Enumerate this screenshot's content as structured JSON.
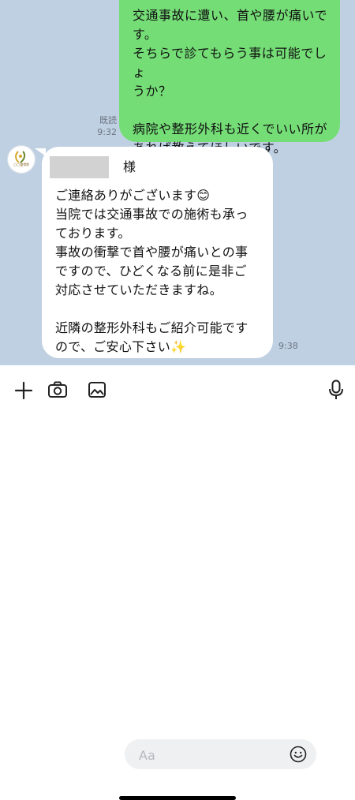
{
  "chat": {
    "outgoing": {
      "text": "交通事故に遭い、首や腰が痛いで\nす。\nそちらで診てもらう事は可能でしょ\nうか？\n\n病院や整形外科も近くでいい所が\nあれば教えてほしいです。",
      "read_label": "既読",
      "time": "9:32"
    },
    "incoming": {
      "avatar_text": "◯◯整骨院",
      "name_suffix": "様",
      "text": "ご連絡ありがございます😊\n当院では交通事故での施術も承っ\nております。\n事故の衝撃で首や腰が痛いとの事\nですので、ひどくなる前に是非ご\n対応させていただきますね。\n\n近隣の整形外科もご紹介可能です\nので、ご安心下さい✨",
      "time": "9:38"
    }
  },
  "input": {
    "placeholder": "Aa"
  },
  "icons": {
    "add": "plus-icon",
    "camera": "camera-icon",
    "image": "image-icon",
    "emoji": "emoji-icon",
    "mic": "mic-icon"
  },
  "colors": {
    "chat_bg": "#bfd0e3",
    "outgoing_bubble": "#74dd76",
    "incoming_bubble": "#ffffff"
  }
}
